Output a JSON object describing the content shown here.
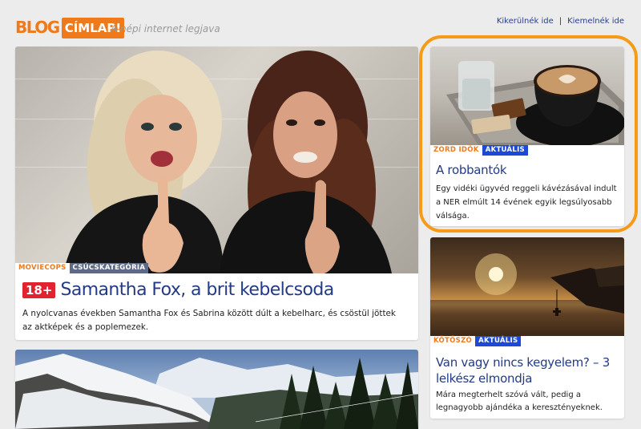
{
  "header": {
    "logo_blog": "BLOG",
    "logo_badge": "CÍMLAP!",
    "tagline": "A népi internet legjava",
    "links": [
      {
        "label": "Kikerülnék ide"
      },
      {
        "label": "Kiemelnék ide"
      }
    ],
    "link_separator": "|"
  },
  "main_story": {
    "tag_source": "MOVIECOPS",
    "tag_category": "CSÚCSKATEGÓRIA",
    "age_badge": "18+",
    "title": "Samantha Fox, a brit kebelcsoda",
    "lead": "A nyolcvanas években Samantha Fox és Sabrina között dúlt a kebelharc, és csöstül jöttek az aktképek és a poplemezek."
  },
  "right_top_story": {
    "tag_source": "ZORD IDŐK",
    "tag_category": "AKTUÁLIS",
    "title": "A robbantók",
    "lead": "Egy vidéki ügyvéd reggeli kávézásával indult a NER elmúlt 14 évének egyik legsúlyosabb válsága."
  },
  "right_bottom_story": {
    "tag_source": "KÖTŐSZÓ",
    "tag_category": "AKTUÁLIS",
    "title": "Van vagy nincs kegyelem? – 3 lelkész elmondja",
    "lead": "Mára megterhelt szóvá vált, pedig a legnagyobb ajándéka a keresztényeknek."
  },
  "colors": {
    "brand_orange": "#ee7a1c",
    "headline_blue": "#233b86",
    "tag_blue": "#1d49d6",
    "tag_gray": "#5f6a85",
    "badge_red": "#e12330",
    "highlight_orange": "#f59b17",
    "page_bg": "#ececec"
  }
}
